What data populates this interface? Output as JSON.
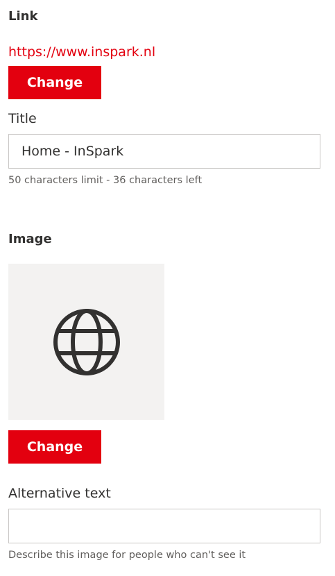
{
  "link": {
    "heading": "Link",
    "url": "https://www.inspark.nl",
    "change_label": "Change"
  },
  "title": {
    "label": "Title",
    "value": "Home - InSpark",
    "hint": "50 characters limit - 36 characters left"
  },
  "image": {
    "heading": "Image",
    "icon": "globe-icon",
    "change_label": "Change"
  },
  "alt_text": {
    "label": "Alternative text",
    "value": "",
    "hint": "Describe this image for people who can't see it"
  },
  "colors": {
    "accent": "#e3000f",
    "text": "#323130",
    "muted": "#605e5c",
    "border": "#c8c6c4",
    "image_bg": "#f3f2f1"
  }
}
